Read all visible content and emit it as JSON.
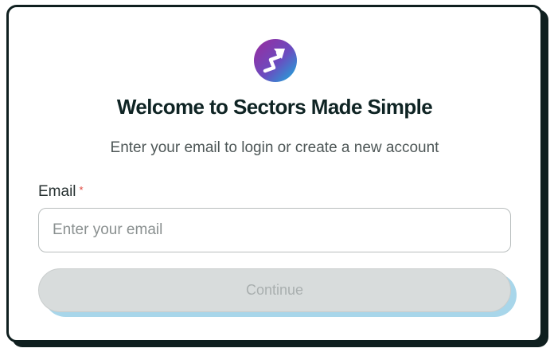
{
  "brand": {
    "logo_icon": "trending-up-arrow-icon",
    "logo_gradient": [
      "#8a2a9a",
      "#1aa6d8"
    ]
  },
  "header": {
    "title": "Welcome to Sectors Made Simple",
    "subtitle": "Enter your email to login or create a new account"
  },
  "form": {
    "email_label": "Email",
    "required_marker": "*",
    "email_value": "",
    "email_placeholder": "Enter your email",
    "continue_label": "Continue",
    "continue_disabled": true
  },
  "colors": {
    "border": "#0f1f1f",
    "required": "#e0433a",
    "button_disabled_bg": "#d8dcdc",
    "button_shadow": "#a8d6ea"
  }
}
